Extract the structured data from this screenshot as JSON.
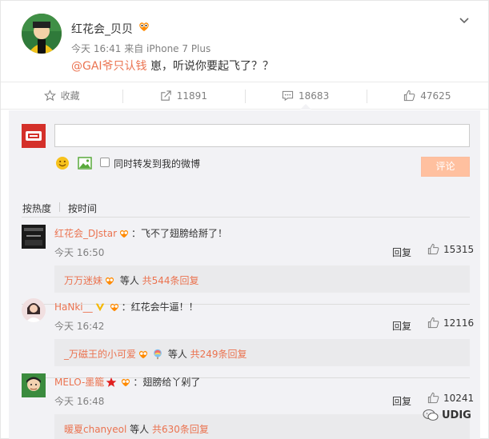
{
  "post": {
    "author": "红花会_贝贝",
    "time": "今天 16:41",
    "source": "来自 iPhone 7 Plus",
    "mention": "@GAI爷只认钱",
    "text": " 崽，听说你要起飞了？？"
  },
  "actions": {
    "favorite_label": "收藏",
    "repost_count": "11891",
    "comment_count": "18683",
    "like_count": "47625"
  },
  "composer": {
    "input_value": "",
    "repost_label": "同时转发到我的微博",
    "submit_label": "评论"
  },
  "sort": {
    "hot_label": "按热度",
    "time_label": "按时间"
  },
  "comments": [
    {
      "name": "红花会_DJstar",
      "text": "：飞不了翅膀给掰了！",
      "time": "今天 16:50",
      "reply_label": "回复",
      "likes": "15315",
      "sub_name": "万万迷妹",
      "sub_mid": " 等人 ",
      "sub_count": "共544条回复"
    },
    {
      "name": "HaNki__",
      "text": "：红花会牛逼！！",
      "time": "今天 16:42",
      "reply_label": "回复",
      "likes": "12116",
      "sub_name": "_万磁王的小可爱",
      "sub_mid": " 等人 ",
      "sub_count": "共249条回复"
    },
    {
      "name": "MELO-墨籠",
      "text": "：翅膀给丫剁了",
      "time": "今天 16:48",
      "reply_label": "回复",
      "likes": "10241",
      "sub_name": "暖夏chanyeol",
      "sub_mid": " 等人 ",
      "sub_count": "共630条回复"
    }
  ],
  "watermark": "UDIG",
  "colors": {
    "accent": "#eb7350",
    "panel_bg": "#f2f2f5",
    "submit_bg": "#ffc09f"
  }
}
